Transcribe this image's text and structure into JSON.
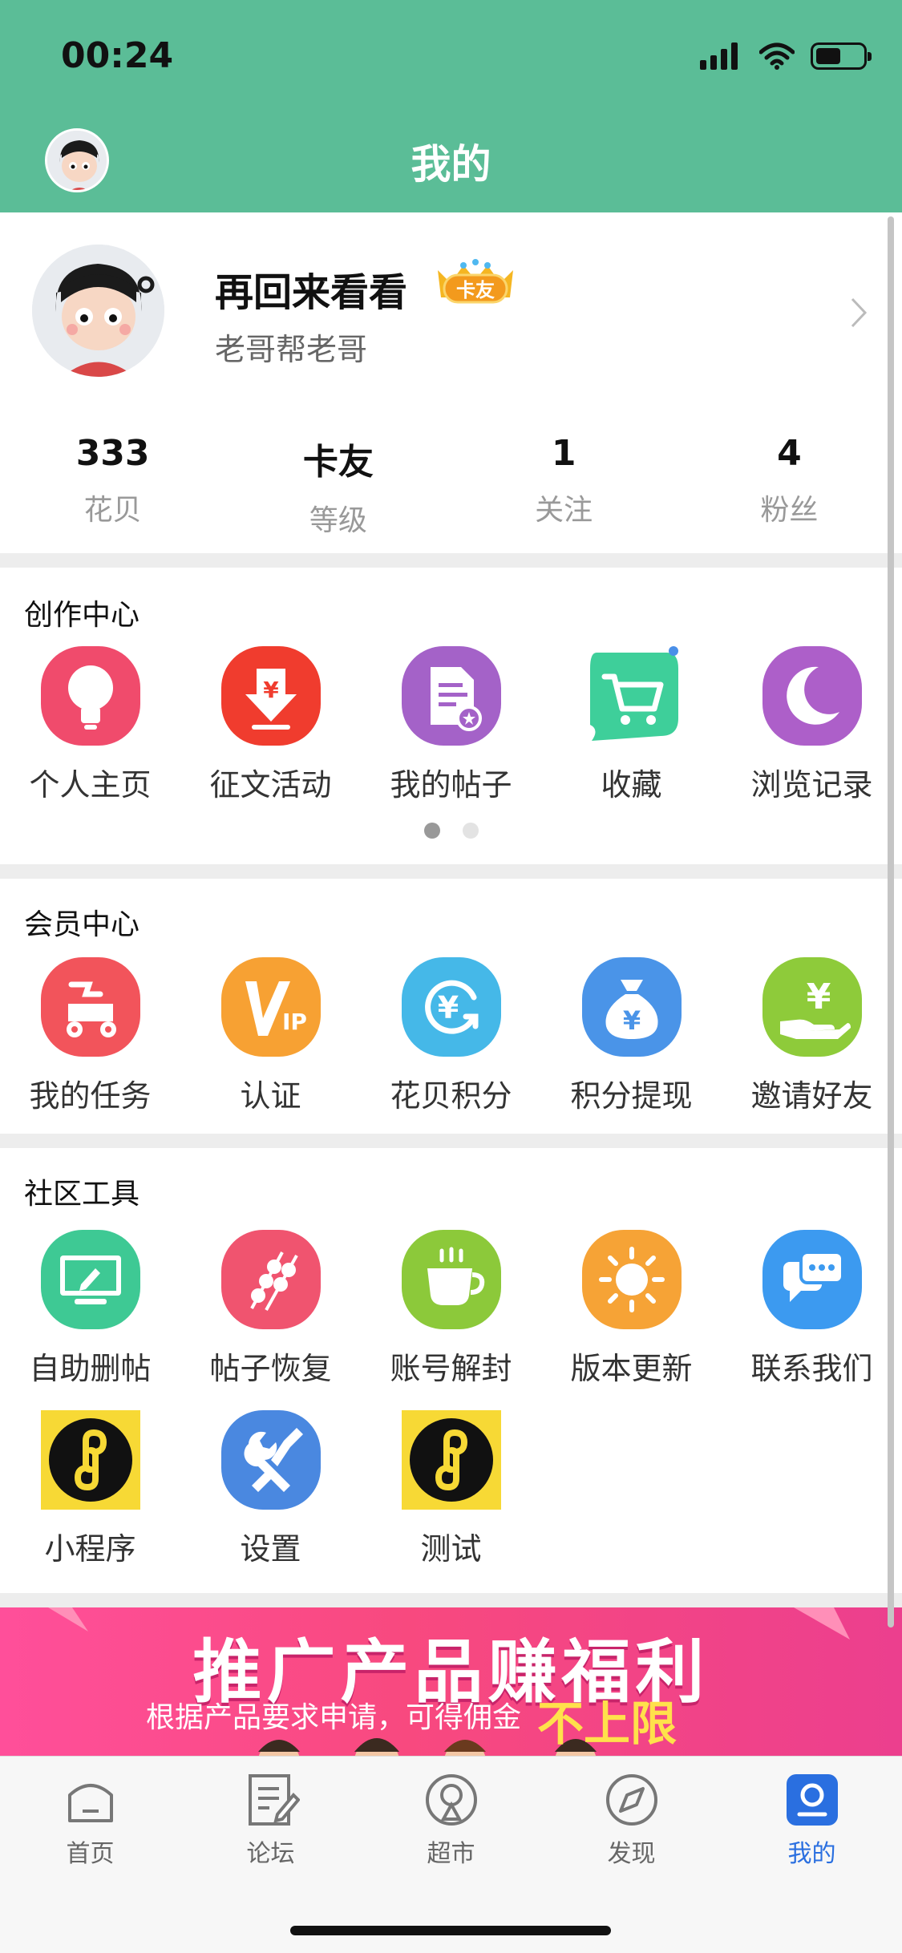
{
  "status_bar": {
    "time": "00:24"
  },
  "header": {
    "title": "我的"
  },
  "profile": {
    "name": "再回来看看",
    "badge_label": "卡友",
    "subtitle": "老哥帮老哥",
    "stats": [
      {
        "value": "333",
        "label": "花贝"
      },
      {
        "value": "卡友",
        "label": "等级"
      },
      {
        "value": "1",
        "label": "关注"
      },
      {
        "value": "4",
        "label": "粉丝"
      }
    ]
  },
  "creation_center": {
    "title": "创作中心",
    "items": [
      {
        "label": "个人主页",
        "icon": "lightbulb-icon",
        "color": "#f04b6c"
      },
      {
        "label": "征文活动",
        "icon": "download-yuan-icon",
        "color": "#f03c2e"
      },
      {
        "label": "我的帖子",
        "icon": "document-icon",
        "color": "#a462c8"
      },
      {
        "label": "收藏",
        "icon": "cart-icon",
        "color": "#3ecf9a"
      },
      {
        "label": "浏览记录",
        "icon": "moon-icon",
        "color": "#ad5fc9"
      }
    ]
  },
  "member_center": {
    "title": "会员中心",
    "items": [
      {
        "label": "我的任务",
        "icon": "scooter-icon",
        "color": "#f2545b"
      },
      {
        "label": "认证",
        "icon": "vip-icon",
        "color": "#f7a133"
      },
      {
        "label": "花贝积分",
        "icon": "yuan-refresh-icon",
        "color": "#45b8e8"
      },
      {
        "label": "积分提现",
        "icon": "money-bag-icon",
        "color": "#4a94e8"
      },
      {
        "label": "邀请好友",
        "icon": "hand-yuan-icon",
        "color": "#8ecb3a"
      }
    ]
  },
  "community_tools": {
    "title": "社区工具",
    "row1": [
      {
        "label": "自助删帖",
        "icon": "monitor-icon",
        "color": "#3ec994"
      },
      {
        "label": "帖子恢复",
        "icon": "skewer-icon",
        "color": "#f0546f"
      },
      {
        "label": "账号解封",
        "icon": "coffee-icon",
        "color": "#8cc93a"
      },
      {
        "label": "版本更新",
        "icon": "sun-icon",
        "color": "#f6a336"
      },
      {
        "label": "联系我们",
        "icon": "chat-icon",
        "color": "#3c9af0"
      }
    ],
    "row2": [
      {
        "label": "小程序",
        "icon": "mini-program-icon",
        "color": "#f7d935"
      },
      {
        "label": "设置",
        "icon": "wrench-icon",
        "color": "#4a88e0"
      },
      {
        "label": "测试",
        "icon": "mini-program-icon",
        "color": "#f7d935"
      }
    ]
  },
  "banner": {
    "title": "推广产品赚福利",
    "subtitle": "根据产品要求申请，可得佣金",
    "highlight": "不上限"
  },
  "tabbar": {
    "items": [
      {
        "label": "首页",
        "icon": "home-icon"
      },
      {
        "label": "论坛",
        "icon": "forum-icon"
      },
      {
        "label": "超市",
        "icon": "market-icon"
      },
      {
        "label": "发现",
        "icon": "compass-icon"
      },
      {
        "label": "我的",
        "icon": "profile-icon",
        "active": true
      }
    ],
    "active_color": "#2a6fe0"
  },
  "colors": {
    "header_bg": "#5bbd97",
    "pager_active": "#999999",
    "pager_inactive": "#e3e3e3"
  }
}
